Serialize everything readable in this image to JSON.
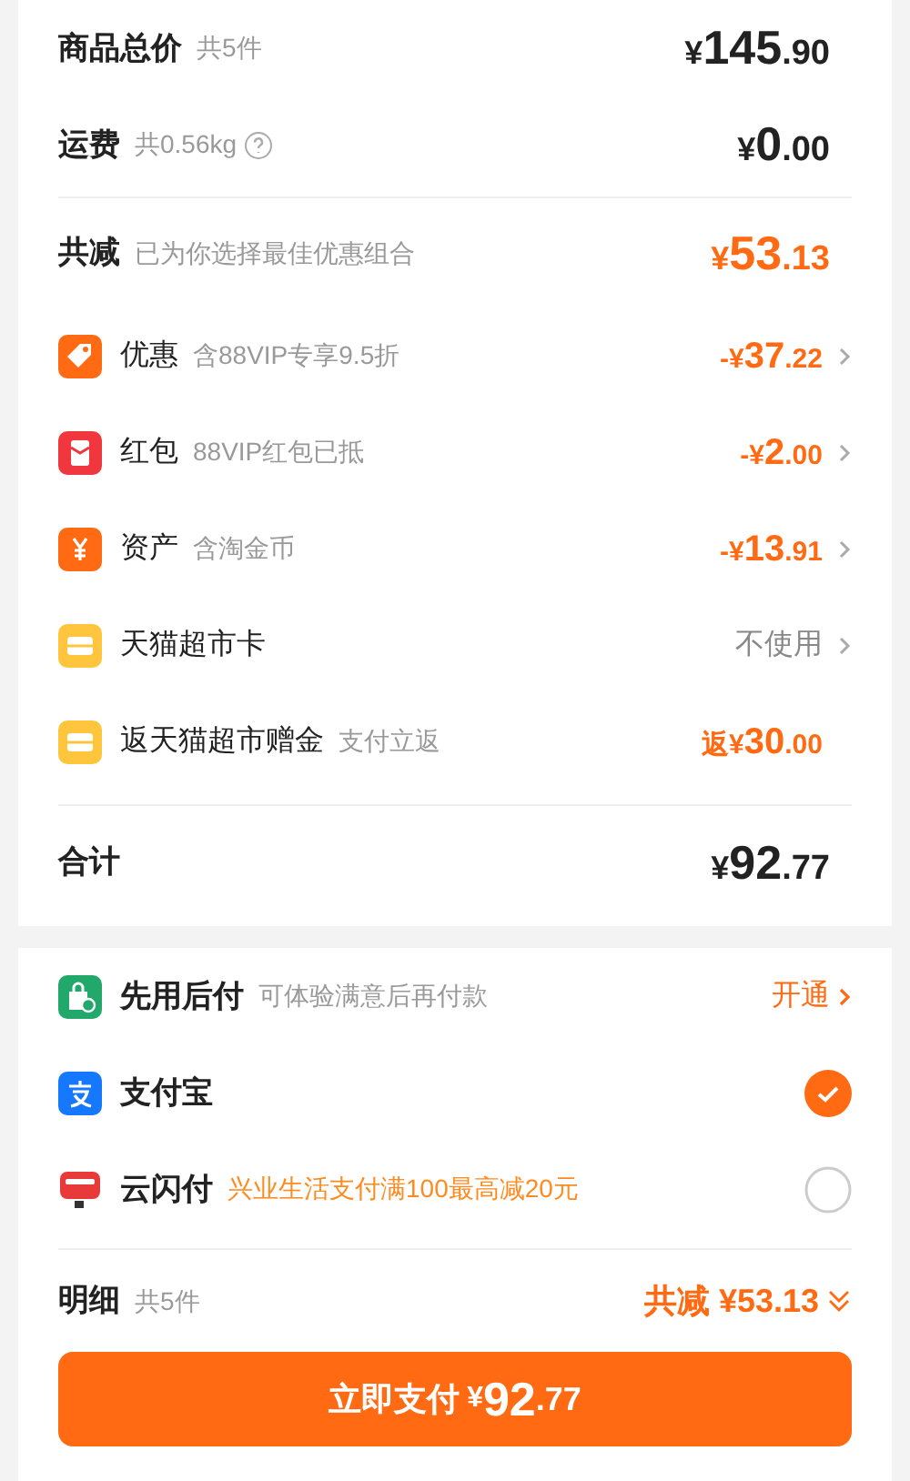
{
  "summary": [
    {
      "label": "商品总价",
      "note": "共5件",
      "help": false,
      "amount": {
        "prefix": "¥",
        "main": "145",
        "fraction": ".90"
      }
    },
    {
      "label": "运费",
      "note": "共0.56kg",
      "help": true,
      "amount": {
        "prefix": "¥",
        "main": "0",
        "fraction": ".00"
      }
    }
  ],
  "discount": {
    "label": "共减",
    "note": "已为你选择最佳优惠组合",
    "amount": {
      "prefix": "¥",
      "main": "53",
      "fraction": ".13"
    }
  },
  "discount_items": [
    {
      "label": "优惠",
      "note": "含88VIP专享9.5折",
      "value": {
        "kind": "amount",
        "prefix": "-¥",
        "main": "37",
        "fraction": ".22"
      },
      "chevron": true
    },
    {
      "label": "红包",
      "note": "88VIP红包已抵",
      "value": {
        "kind": "amount",
        "prefix": "-¥",
        "main": "2",
        "fraction": ".00"
      },
      "chevron": true
    },
    {
      "label": "资产",
      "note": "含淘金币",
      "value": {
        "kind": "amount",
        "prefix": "-¥",
        "main": "13",
        "fraction": ".91"
      },
      "chevron": true
    },
    {
      "label": "天猫超市卡",
      "value": {
        "kind": "text",
        "text": "不使用"
      },
      "chevron": true
    },
    {
      "label": "返天猫超市赠金",
      "note": "支付立返",
      "value": {
        "kind": "amount",
        "prefix": "返¥",
        "main": "30",
        "fraction": ".00"
      },
      "chevron": false
    }
  ],
  "total": {
    "label": "合计",
    "amount": {
      "prefix": "¥",
      "main": "92",
      "fraction": ".77"
    }
  },
  "payment_methods": [
    {
      "label": "先用后付",
      "note": "可体验满意后再付款",
      "note_highlight": false,
      "kind": "action",
      "action": "开通"
    },
    {
      "label": "支付宝",
      "kind": "radio",
      "selected": true
    },
    {
      "label": "云闪付",
      "note": "兴业生活支付满100最高减20元",
      "note_highlight": true,
      "kind": "radio",
      "selected": false
    }
  ],
  "detail": {
    "label": "明细",
    "note": "共5件",
    "saving": "共减 ¥53.13"
  },
  "pay_button": {
    "label": "立即支付",
    "prefix": "¥",
    "main": "92",
    "fraction": ".77"
  }
}
